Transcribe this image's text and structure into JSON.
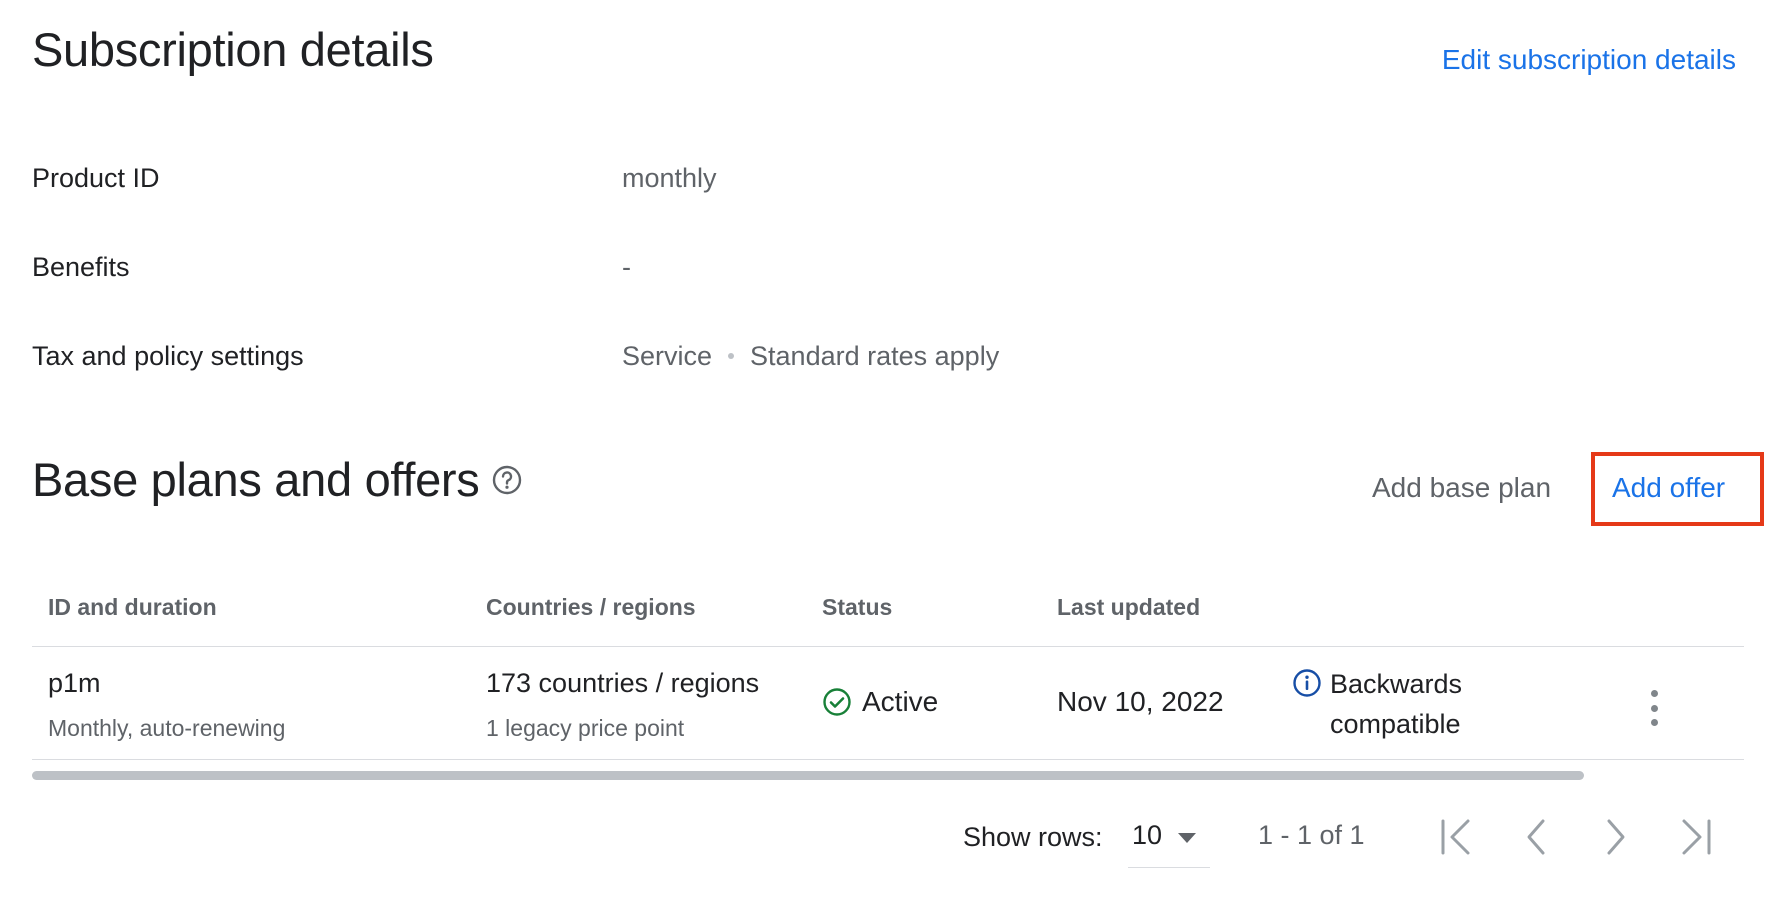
{
  "header": {
    "title": "Subscription details",
    "edit_link": "Edit subscription details"
  },
  "details": [
    {
      "label": "Product ID",
      "value": "monthly"
    },
    {
      "label": "Benefits",
      "value": "-"
    },
    {
      "label": "Tax and policy settings",
      "value_parts": [
        "Service",
        "Standard rates apply"
      ]
    }
  ],
  "base_plans": {
    "title": "Base plans and offers",
    "help_icon": "help-circle-icon",
    "add_base_plan": "Add base plan",
    "add_offer": "Add offer",
    "highlight_color": "#e53918"
  },
  "table": {
    "columns": [
      "ID and duration",
      "Countries / regions",
      "Status",
      "Last updated"
    ],
    "rows": [
      {
        "id": "p1m",
        "duration": "Monthly, auto-renewing",
        "countries": "173 countries / regions",
        "price_points": "1 legacy price point",
        "status": "Active",
        "status_icon": "check-circle-icon",
        "status_color": "#188038",
        "last_updated": "Nov 10, 2022",
        "compat_icon": "info-icon",
        "compat_line1": "Backwards",
        "compat_line2": "compatible"
      }
    ]
  },
  "pagination": {
    "show_rows_label": "Show rows:",
    "rows_value": "10",
    "range": "1 - 1 of 1"
  },
  "colors": {
    "link": "#1a73e8",
    "text": "#202124",
    "muted": "#5f6368"
  }
}
